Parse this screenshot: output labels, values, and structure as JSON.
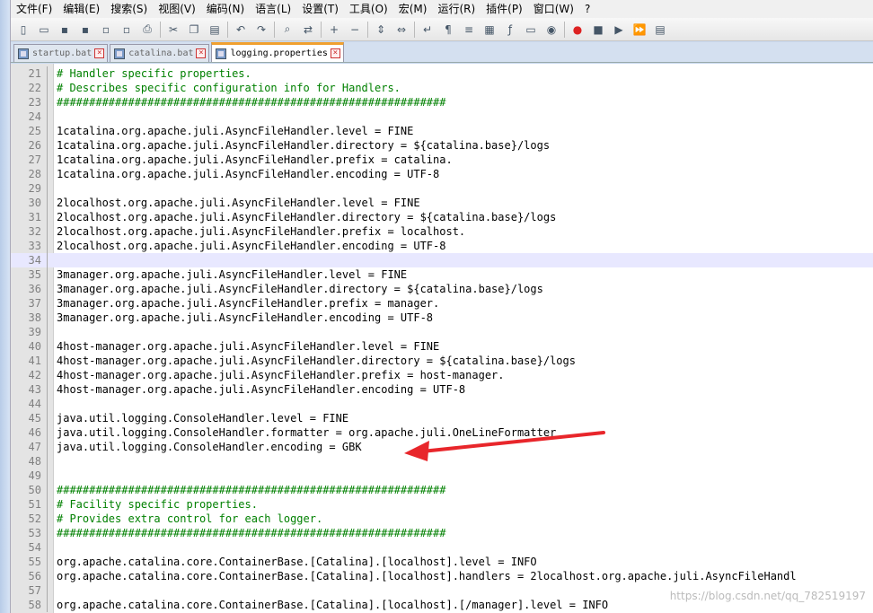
{
  "menu": [
    "文件(F)",
    "编辑(E)",
    "搜索(S)",
    "视图(V)",
    "编码(N)",
    "语言(L)",
    "设置(T)",
    "工具(O)",
    "宏(M)",
    "运行(R)",
    "插件(P)",
    "窗口(W)",
    "?"
  ],
  "toolbar_icons": [
    "new-file-icon",
    "open-file-icon",
    "save-icon",
    "save-all-icon",
    "close-icon",
    "close-all-icon",
    "print-icon",
    "cut-icon",
    "copy-icon",
    "paste-icon",
    "undo-icon",
    "redo-icon",
    "find-icon",
    "replace-icon",
    "zoom-in-icon",
    "zoom-out-icon",
    "sync-v-icon",
    "sync-h-icon",
    "wrap-icon",
    "show-all-chars-icon",
    "indent-guide-icon",
    "doc-map-icon",
    "function-list-icon",
    "folder-workspace-icon",
    "monitor-icon",
    "record-macro-icon",
    "stop-macro-icon",
    "play-macro-icon",
    "run-macro-multiple-icon",
    "save-macro-icon"
  ],
  "tabs": [
    {
      "label": "startup.bat",
      "active": false
    },
    {
      "label": "catalina.bat",
      "active": false
    },
    {
      "label": "logging.properties",
      "active": true
    }
  ],
  "editor": {
    "lines": [
      {
        "n": "21",
        "text": "# Handler specific properties.",
        "comment": true
      },
      {
        "n": "22",
        "text": "# Describes specific configuration info for Handlers.",
        "comment": true
      },
      {
        "n": "23",
        "text": "############################################################",
        "comment": true
      },
      {
        "n": "24",
        "text": "",
        "comment": false
      },
      {
        "n": "25",
        "text": "1catalina.org.apache.juli.AsyncFileHandler.level = FINE",
        "comment": false
      },
      {
        "n": "26",
        "text": "1catalina.org.apache.juli.AsyncFileHandler.directory = ${catalina.base}/logs",
        "comment": false
      },
      {
        "n": "27",
        "text": "1catalina.org.apache.juli.AsyncFileHandler.prefix = catalina.",
        "comment": false
      },
      {
        "n": "28",
        "text": "1catalina.org.apache.juli.AsyncFileHandler.encoding = UTF-8",
        "comment": false
      },
      {
        "n": "29",
        "text": "",
        "comment": false
      },
      {
        "n": "30",
        "text": "2localhost.org.apache.juli.AsyncFileHandler.level = FINE",
        "comment": false
      },
      {
        "n": "31",
        "text": "2localhost.org.apache.juli.AsyncFileHandler.directory = ${catalina.base}/logs",
        "comment": false
      },
      {
        "n": "32",
        "text": "2localhost.org.apache.juli.AsyncFileHandler.prefix = localhost.",
        "comment": false
      },
      {
        "n": "33",
        "text": "2localhost.org.apache.juli.AsyncFileHandler.encoding = UTF-8",
        "comment": false
      },
      {
        "n": "34",
        "text": "",
        "comment": false,
        "current": true
      },
      {
        "n": "35",
        "text": "3manager.org.apache.juli.AsyncFileHandler.level = FINE",
        "comment": false
      },
      {
        "n": "36",
        "text": "3manager.org.apache.juli.AsyncFileHandler.directory = ${catalina.base}/logs",
        "comment": false
      },
      {
        "n": "37",
        "text": "3manager.org.apache.juli.AsyncFileHandler.prefix = manager.",
        "comment": false
      },
      {
        "n": "38",
        "text": "3manager.org.apache.juli.AsyncFileHandler.encoding = UTF-8",
        "comment": false
      },
      {
        "n": "39",
        "text": "",
        "comment": false
      },
      {
        "n": "40",
        "text": "4host-manager.org.apache.juli.AsyncFileHandler.level = FINE",
        "comment": false
      },
      {
        "n": "41",
        "text": "4host-manager.org.apache.juli.AsyncFileHandler.directory = ${catalina.base}/logs",
        "comment": false
      },
      {
        "n": "42",
        "text": "4host-manager.org.apache.juli.AsyncFileHandler.prefix = host-manager.",
        "comment": false
      },
      {
        "n": "43",
        "text": "4host-manager.org.apache.juli.AsyncFileHandler.encoding = UTF-8",
        "comment": false
      },
      {
        "n": "44",
        "text": "",
        "comment": false
      },
      {
        "n": "45",
        "text": "java.util.logging.ConsoleHandler.level = FINE",
        "comment": false
      },
      {
        "n": "46",
        "text": "java.util.logging.ConsoleHandler.formatter = org.apache.juli.OneLineFormatter",
        "comment": false
      },
      {
        "n": "47",
        "text": "java.util.logging.ConsoleHandler.encoding = GBK",
        "comment": false
      },
      {
        "n": "48",
        "text": "",
        "comment": false
      },
      {
        "n": "49",
        "text": "",
        "comment": false
      },
      {
        "n": "50",
        "text": "############################################################",
        "comment": true
      },
      {
        "n": "51",
        "text": "# Facility specific properties.",
        "comment": true
      },
      {
        "n": "52",
        "text": "# Provides extra control for each logger.",
        "comment": true
      },
      {
        "n": "53",
        "text": "############################################################",
        "comment": true
      },
      {
        "n": "54",
        "text": "",
        "comment": false
      },
      {
        "n": "55",
        "text": "org.apache.catalina.core.ContainerBase.[Catalina].[localhost].level = INFO",
        "comment": false
      },
      {
        "n": "56",
        "text": "org.apache.catalina.core.ContainerBase.[Catalina].[localhost].handlers = 2localhost.org.apache.juli.AsyncFileHandl",
        "comment": false
      },
      {
        "n": "57",
        "text": "",
        "comment": false
      },
      {
        "n": "58",
        "text": "org.apache.catalina.core.ContainerBase.[Catalina].[localhost].[/manager].level = INFO",
        "comment": false
      }
    ]
  },
  "watermark": "https://blog.csdn.net/qq_782519197",
  "colors": {
    "comment": "#008000",
    "arrow": "#e8262b",
    "current_line": "#e8e8ff"
  }
}
